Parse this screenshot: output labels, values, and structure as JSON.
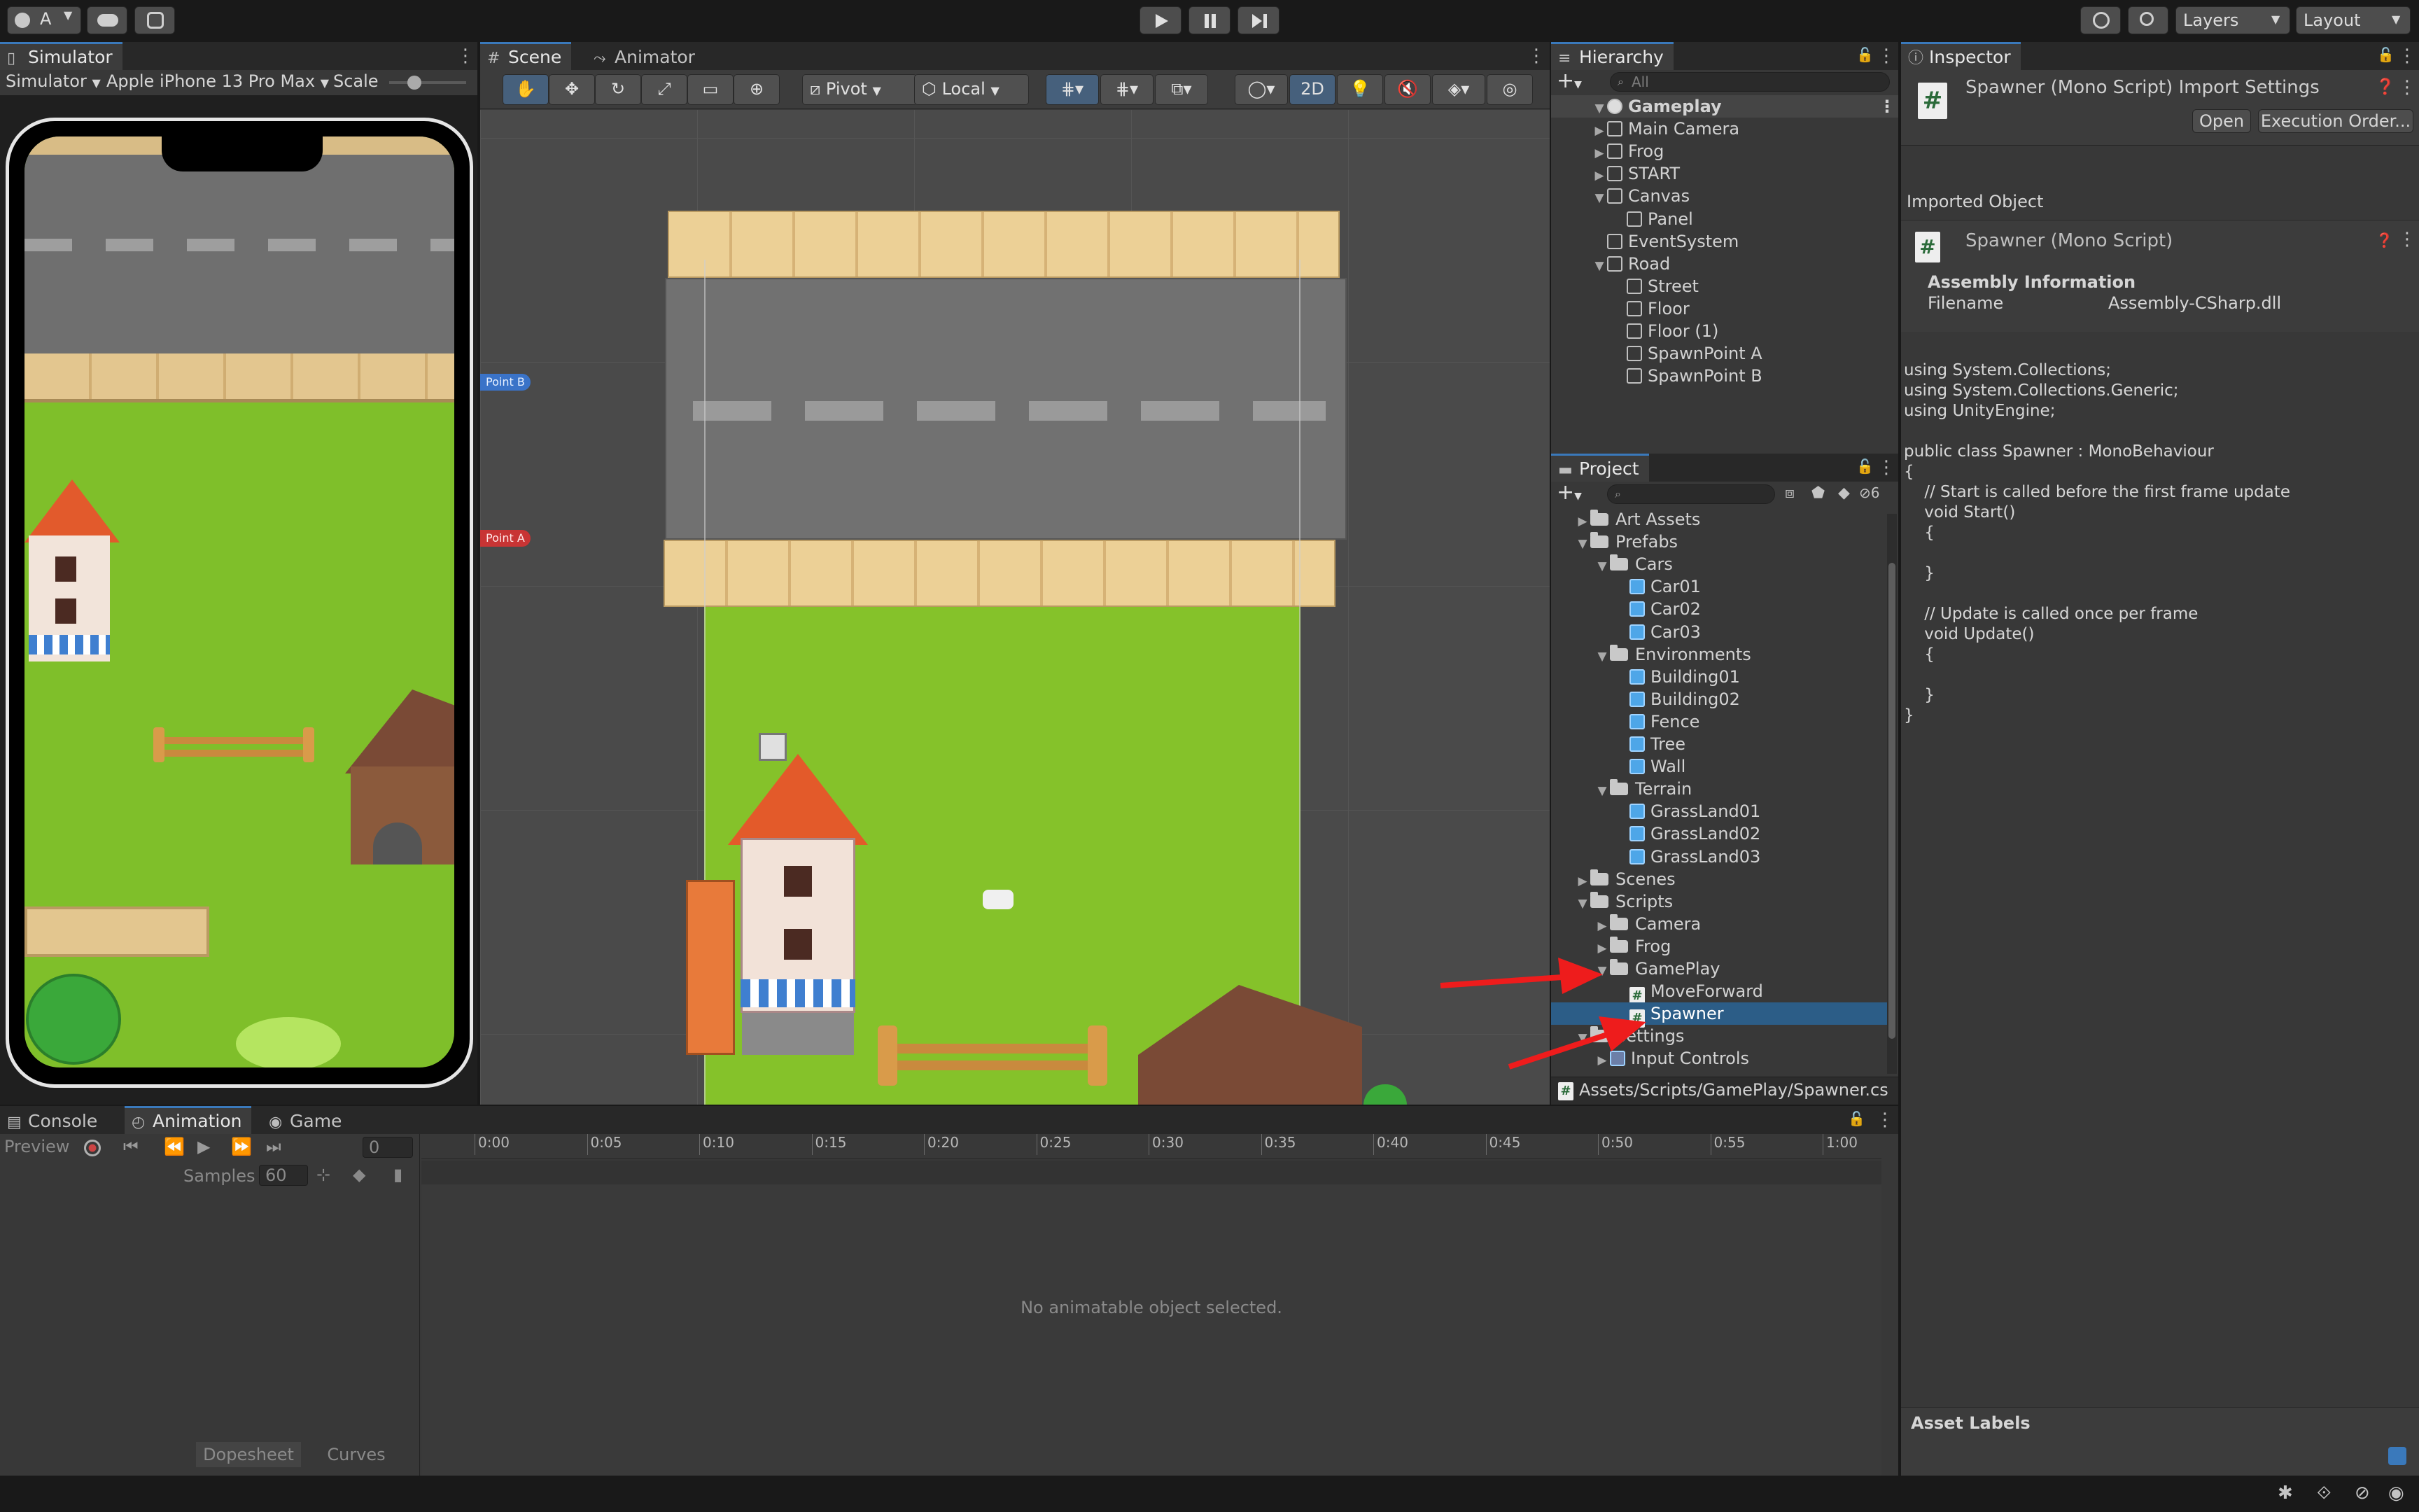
{
  "toolbar": {
    "account_label": "A",
    "layers_label": "Layers",
    "layout_label": "Layout"
  },
  "simulator": {
    "tab": "Simulator",
    "mode": "Simulator",
    "device": "Apple iPhone 13 Pro Max",
    "scale_label": "Scale"
  },
  "scene": {
    "tabs": [
      "Scene",
      "Animator"
    ],
    "pivot": "Pivot",
    "local": "Local",
    "mode_2d": "2D",
    "point_b": "Point B",
    "point_a": "Point A"
  },
  "hierarchy": {
    "tab": "Hierarchy",
    "search_placeholder": "All",
    "items": [
      {
        "label": "Gameplay",
        "depth": 0,
        "expanded": true,
        "kind": "scene"
      },
      {
        "label": "Main Camera",
        "depth": 1,
        "expanded": false,
        "kind": "object"
      },
      {
        "label": "Frog",
        "depth": 1,
        "expanded": false,
        "kind": "object"
      },
      {
        "label": "START",
        "depth": 1,
        "expanded": false,
        "kind": "object"
      },
      {
        "label": "Canvas",
        "depth": 1,
        "expanded": true,
        "kind": "object"
      },
      {
        "label": "Panel",
        "depth": 2,
        "kind": "object"
      },
      {
        "label": "EventSystem",
        "depth": 1,
        "kind": "object"
      },
      {
        "label": "Road",
        "depth": 1,
        "expanded": true,
        "kind": "object"
      },
      {
        "label": "Street",
        "depth": 2,
        "kind": "object"
      },
      {
        "label": "Floor",
        "depth": 2,
        "kind": "object"
      },
      {
        "label": "Floor (1)",
        "depth": 2,
        "kind": "object"
      },
      {
        "label": "SpawnPoint A",
        "depth": 2,
        "kind": "object"
      },
      {
        "label": "SpawnPoint B",
        "depth": 2,
        "kind": "object"
      }
    ]
  },
  "project": {
    "tab": "Project",
    "hidden_count": "6",
    "path": "Assets/Scripts/GamePlay/Spawner.cs",
    "items": [
      {
        "label": "Art Assets",
        "depth": 1,
        "kind": "folder",
        "expanded": false
      },
      {
        "label": "Prefabs",
        "depth": 1,
        "kind": "folder",
        "expanded": true
      },
      {
        "label": "Cars",
        "depth": 2,
        "kind": "folder",
        "expanded": true
      },
      {
        "label": "Car01",
        "depth": 3,
        "kind": "prefab"
      },
      {
        "label": "Car02",
        "depth": 3,
        "kind": "prefab"
      },
      {
        "label": "Car03",
        "depth": 3,
        "kind": "prefab"
      },
      {
        "label": "Environments",
        "depth": 2,
        "kind": "folder",
        "expanded": true
      },
      {
        "label": "Building01",
        "depth": 3,
        "kind": "prefab"
      },
      {
        "label": "Building02",
        "depth": 3,
        "kind": "prefab"
      },
      {
        "label": "Fence",
        "depth": 3,
        "kind": "prefab"
      },
      {
        "label": "Tree",
        "depth": 3,
        "kind": "prefab"
      },
      {
        "label": "Wall",
        "depth": 3,
        "kind": "prefab"
      },
      {
        "label": "Terrain",
        "depth": 2,
        "kind": "folder",
        "expanded": true
      },
      {
        "label": "GrassLand01",
        "depth": 3,
        "kind": "prefab"
      },
      {
        "label": "GrassLand02",
        "depth": 3,
        "kind": "prefab"
      },
      {
        "label": "GrassLand03",
        "depth": 3,
        "kind": "prefab"
      },
      {
        "label": "Scenes",
        "depth": 1,
        "kind": "folder",
        "expanded": false
      },
      {
        "label": "Scripts",
        "depth": 1,
        "kind": "folder",
        "expanded": true
      },
      {
        "label": "Camera",
        "depth": 2,
        "kind": "folder",
        "expanded": false
      },
      {
        "label": "Frog",
        "depth": 2,
        "kind": "folder",
        "expanded": false
      },
      {
        "label": "GamePlay",
        "depth": 2,
        "kind": "folder",
        "expanded": true
      },
      {
        "label": "MoveForward",
        "depth": 3,
        "kind": "script"
      },
      {
        "label": "Spawner",
        "depth": 3,
        "kind": "script",
        "selected": true
      },
      {
        "label": "Settings",
        "depth": 1,
        "kind": "folder",
        "expanded": true
      },
      {
        "label": "Input Controls",
        "depth": 2,
        "kind": "asset",
        "expanded": false
      }
    ]
  },
  "inspector": {
    "tab": "Inspector",
    "title": "Spawner (Mono Script) Import Settings",
    "open_button": "Open",
    "exec_order_button": "Execution Order...",
    "imported_object_label": "Imported Object",
    "object_name": "Spawner (Mono Script)",
    "assembly_header": "Assembly Information",
    "filename_label": "Filename",
    "filename_value": "Assembly-CSharp.dll",
    "code_lines": [
      "using System.Collections;",
      "using System.Collections.Generic;",
      "using UnityEngine;",
      "",
      "public class Spawner : MonoBehaviour",
      "{",
      "    // Start is called before the first frame update",
      "    void Start()",
      "    {",
      "",
      "    }",
      "",
      "    // Update is called once per frame",
      "    void Update()",
      "    {",
      "",
      "    }",
      "}"
    ],
    "asset_labels": "Asset Labels"
  },
  "animation": {
    "tabs": [
      "Console",
      "Animation",
      "Game"
    ],
    "preview_label": "Preview",
    "frame_value": "0",
    "samples_label": "Samples",
    "samples_value": "60",
    "ticks": [
      "0:00",
      "0:05",
      "0:10",
      "0:15",
      "0:20",
      "0:25",
      "0:30",
      "0:35",
      "0:40",
      "0:45",
      "0:50",
      "0:55",
      "1:00"
    ],
    "empty_message": "No animatable object selected.",
    "dopesheet_label": "Dopesheet",
    "curves_label": "Curves"
  },
  "colors": {
    "selection": "#2c5d87",
    "accent": "#3a79bb",
    "annotation_arrow": "#ee1c1c"
  }
}
